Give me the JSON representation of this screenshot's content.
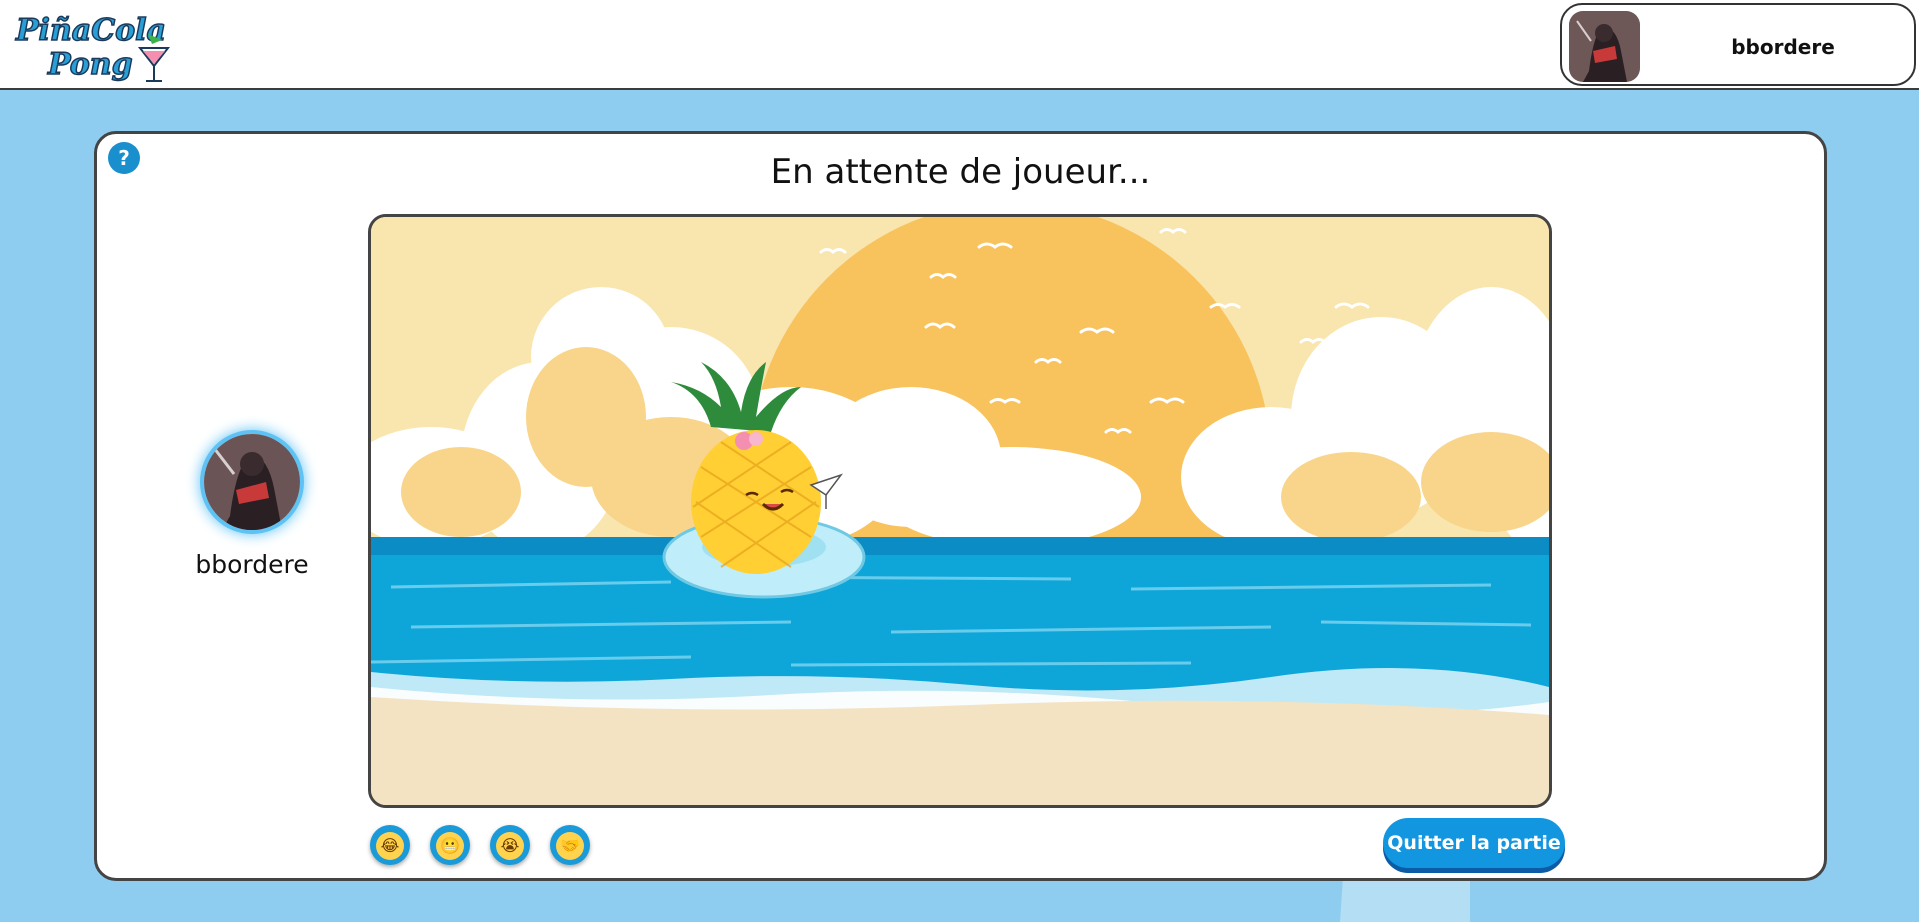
{
  "header": {
    "logo_text_line1": "PiñaCola",
    "logo_text_line2": "Pong",
    "user": {
      "name": "bbordere"
    }
  },
  "game": {
    "help_label": "?",
    "title": "En attente de joueur...",
    "player": {
      "name": "bbordere"
    },
    "emotes": [
      {
        "icon": "laughing-emoji-icon",
        "glyph": "😂"
      },
      {
        "icon": "grimace-emoji-icon",
        "glyph": "😬"
      },
      {
        "icon": "crying-emoji-icon",
        "glyph": "😭"
      },
      {
        "icon": "handshake-emoji-icon",
        "glyph": "🤝"
      }
    ],
    "quit_label": "Quitter la partie"
  },
  "colors": {
    "background": "#8ecdef",
    "accent": "#1296e0",
    "sun": "#f8c25c",
    "sea": "#0ea5d8",
    "sand": "#f3e3c3"
  }
}
